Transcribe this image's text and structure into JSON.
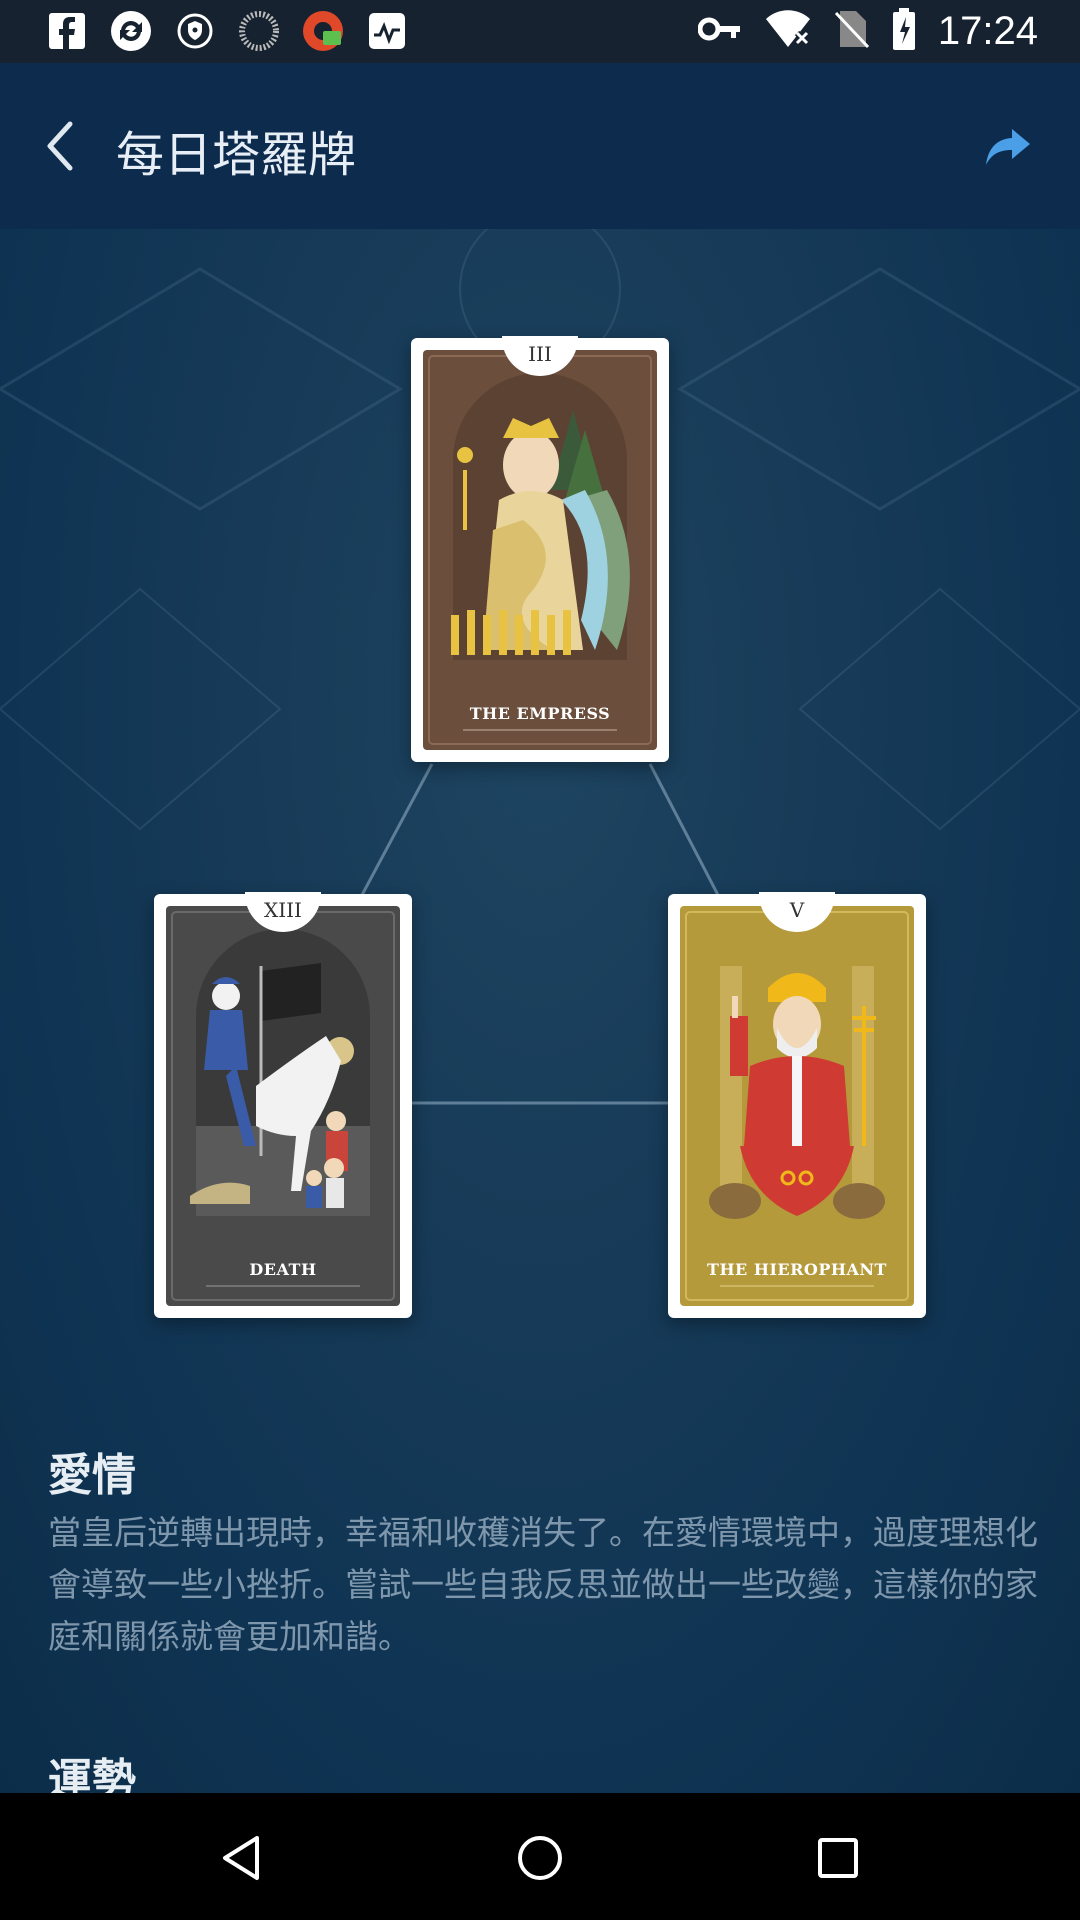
{
  "status_bar": {
    "time": "17:24",
    "left_icons": [
      "facebook-icon",
      "sync-app-icon",
      "vpn-shield-icon",
      "loading-spinner-icon",
      "cast-app-icon",
      "activity-monitor-icon"
    ],
    "right_icons": [
      "vpn-key-icon",
      "wifi-off-icon",
      "no-sim-icon",
      "battery-charging-icon"
    ]
  },
  "app_bar": {
    "title": "每日塔羅牌",
    "back_icon": "back-chevron-icon",
    "share_icon": "share-arrow-icon"
  },
  "cards": [
    {
      "id": "top",
      "numeral": "III",
      "name": "THE EMPRESS",
      "bg": "#6b4e3c"
    },
    {
      "id": "left",
      "numeral": "XIII",
      "name": "DEATH",
      "bg": "#4a4a4a"
    },
    {
      "id": "right",
      "numeral": "V",
      "name": "THE HIEROPHANT",
      "bg": "#b59a3c"
    }
  ],
  "sections": [
    {
      "title": "愛情",
      "text": "當皇后逆轉出現時，幸福和收穫消失了。在愛情環境中，過度理想化會導致一些小挫折。嘗試一些自我反思並做出一些改變，這樣你的家庭和關係就會更加和諧。"
    },
    {
      "title": "運勢",
      "text": ""
    }
  ],
  "nav_bar": {
    "back": "nav-back-icon",
    "home": "nav-home-icon",
    "recents": "nav-recents-icon"
  }
}
